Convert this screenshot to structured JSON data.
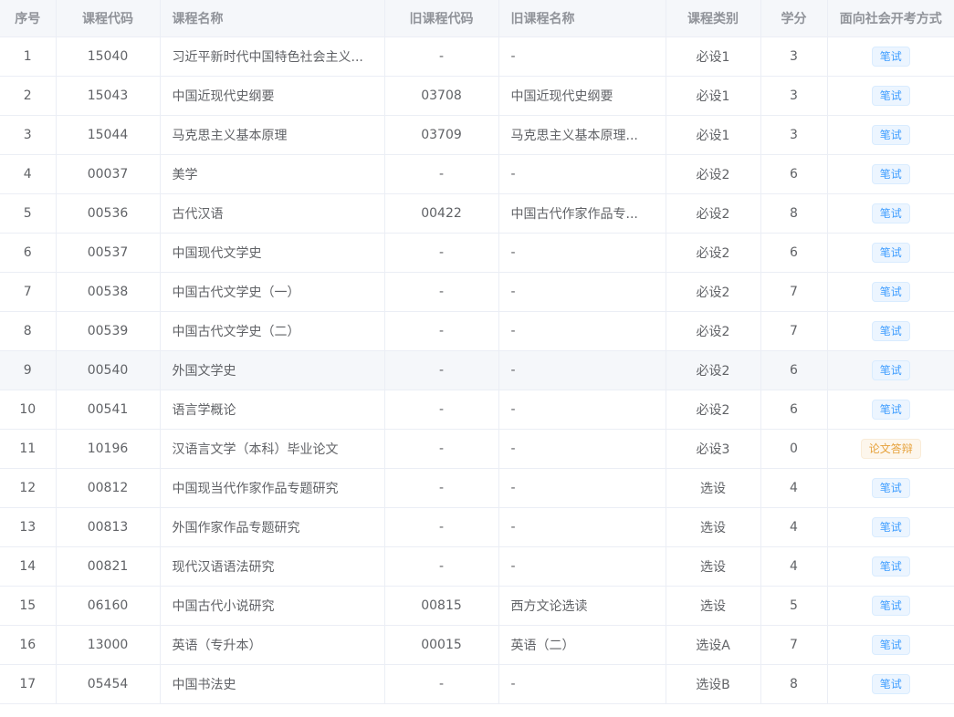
{
  "headers": [
    "序号",
    "课程代码",
    "课程名称",
    "旧课程代码",
    "旧课程名称",
    "课程类别",
    "学分",
    "面向社会开考方式"
  ],
  "colors": {
    "tag_blue": "#409eff",
    "tag_orange": "#e6a23c",
    "header_bg": "#f5f7fa"
  },
  "rows": [
    [
      "1",
      "15040",
      "习近平新时代中国特色社会主义...",
      "-",
      "-",
      "必设1",
      "3",
      "笔试"
    ],
    [
      "2",
      "15043",
      "中国近现代史纲要",
      "03708",
      "中国近现代史纲要",
      "必设1",
      "3",
      "笔试"
    ],
    [
      "3",
      "15044",
      "马克思主义基本原理",
      "03709",
      "马克思主义基本原理...",
      "必设1",
      "3",
      "笔试"
    ],
    [
      "4",
      "00037",
      "美学",
      "-",
      "-",
      "必设2",
      "6",
      "笔试"
    ],
    [
      "5",
      "00536",
      "古代汉语",
      "00422",
      "中国古代作家作品专...",
      "必设2",
      "8",
      "笔试"
    ],
    [
      "6",
      "00537",
      "中国现代文学史",
      "-",
      "-",
      "必设2",
      "6",
      "笔试"
    ],
    [
      "7",
      "00538",
      "中国古代文学史（一）",
      "-",
      "-",
      "必设2",
      "7",
      "笔试"
    ],
    [
      "8",
      "00539",
      "中国古代文学史（二）",
      "-",
      "-",
      "必设2",
      "7",
      "笔试"
    ],
    [
      "9",
      "00540",
      "外国文学史",
      "-",
      "-",
      "必设2",
      "6",
      "笔试"
    ],
    [
      "10",
      "00541",
      "语言学概论",
      "-",
      "-",
      "必设2",
      "6",
      "笔试"
    ],
    [
      "11",
      "10196",
      "汉语言文学（本科）毕业论文",
      "-",
      "-",
      "必设3",
      "0",
      "论文答辩"
    ],
    [
      "12",
      "00812",
      "中国现当代作家作品专题研究",
      "-",
      "-",
      "选设",
      "4",
      "笔试"
    ],
    [
      "13",
      "00813",
      "外国作家作品专题研究",
      "-",
      "-",
      "选设",
      "4",
      "笔试"
    ],
    [
      "14",
      "00821",
      "现代汉语语法研究",
      "-",
      "-",
      "选设",
      "4",
      "笔试"
    ],
    [
      "15",
      "06160",
      "中国古代小说研究",
      "00815",
      "西方文论选读",
      "选设",
      "5",
      "笔试"
    ],
    [
      "16",
      "13000",
      "英语（专升本）",
      "00015",
      "英语（二）",
      "选设A",
      "7",
      "笔试"
    ],
    [
      "17",
      "05454",
      "中国书法史",
      "-",
      "-",
      "选设B",
      "8",
      "笔试"
    ]
  ]
}
